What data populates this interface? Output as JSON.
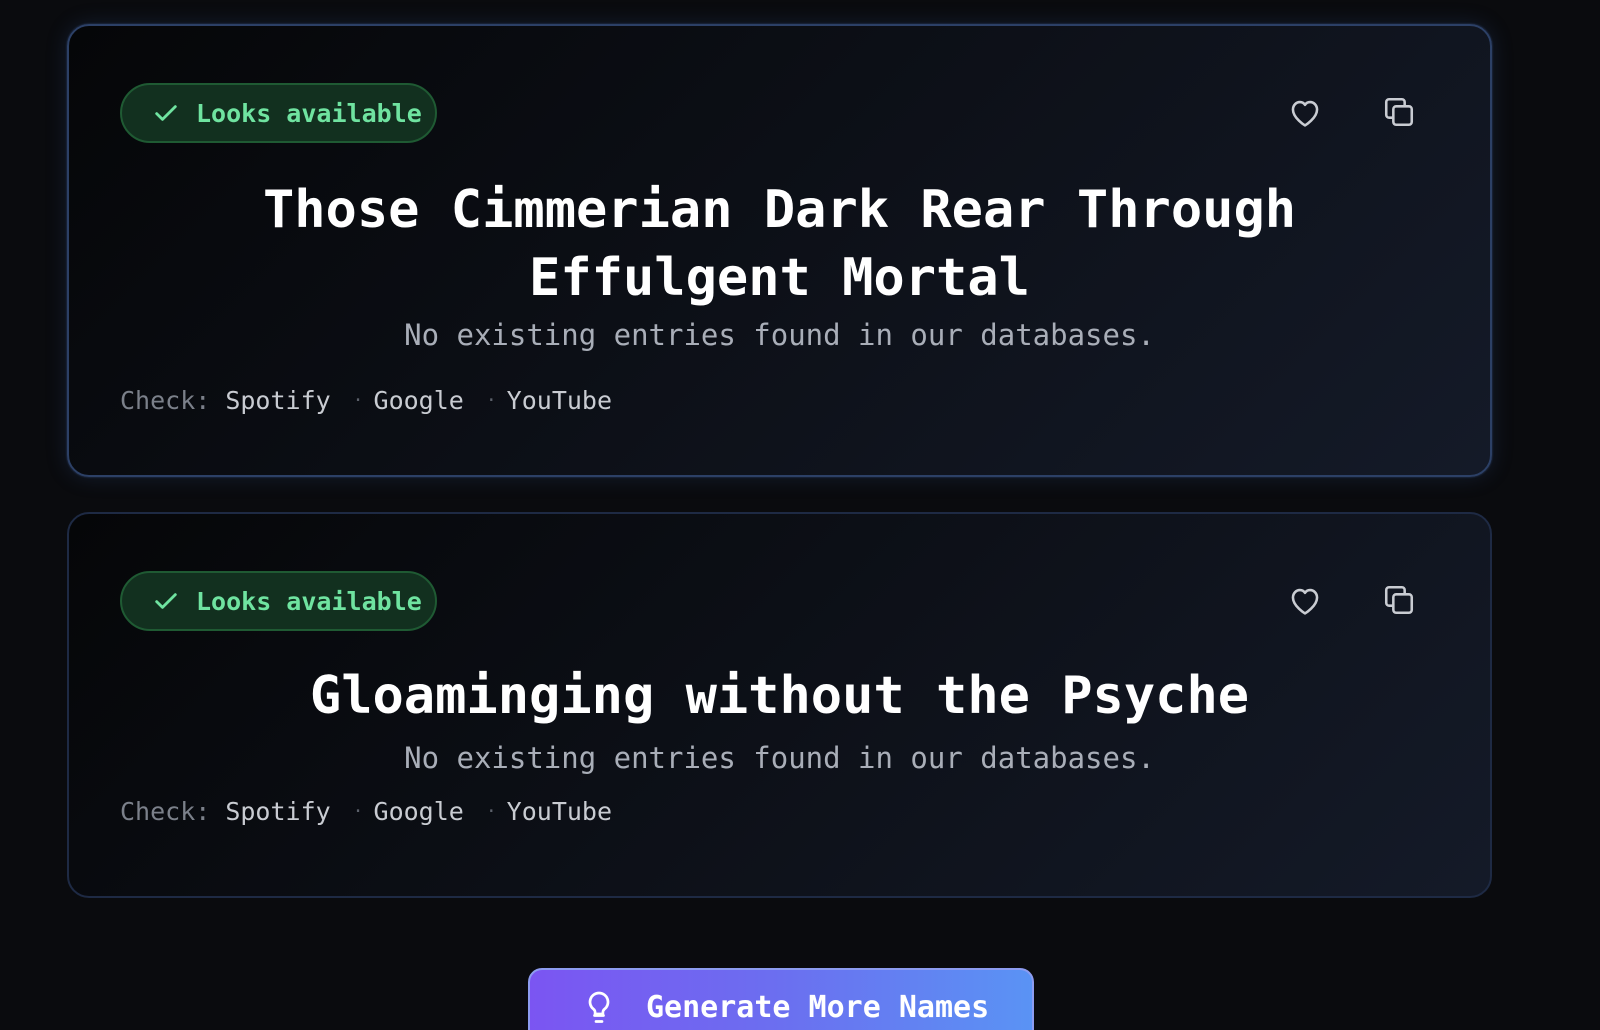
{
  "results": [
    {
      "status": "Looks available",
      "name": "Those Cimmerian Dark Rear Through Effulgent Mortal",
      "description": "No existing entries found in our databases.",
      "check_label": "Check:",
      "links": [
        "Spotify",
        "Google",
        "YouTube"
      ]
    },
    {
      "status": "Looks available",
      "name": "Gloaminging without the Psyche",
      "description": "No existing entries found in our databases.",
      "check_label": "Check:",
      "links": [
        "Spotify",
        "Google",
        "YouTube"
      ]
    }
  ],
  "actions": {
    "separator": "·",
    "favorite_icon": "heart-icon",
    "copy_icon": "copy-icon"
  },
  "generate_button": {
    "label": "Generate More Names",
    "icon": "lightbulb-icon"
  },
  "colors": {
    "background": "#0a0b0e",
    "badge_text": "#6fe3a0",
    "badge_bg": "#12301f",
    "button_gradient_start": "#7b55f2",
    "button_gradient_end": "#5a93f4"
  }
}
